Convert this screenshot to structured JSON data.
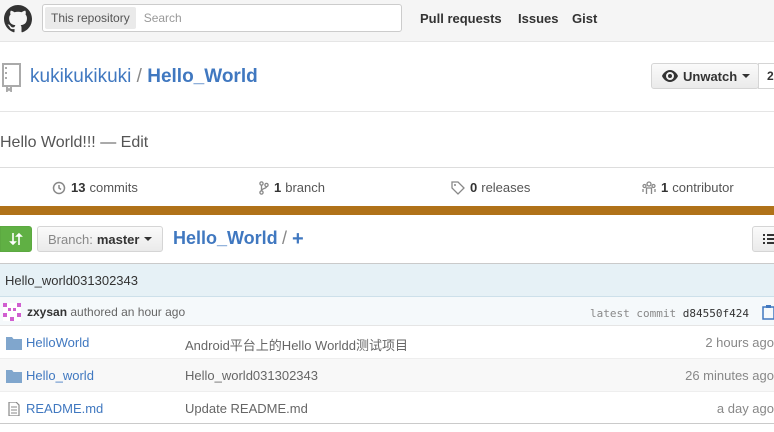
{
  "header": {
    "search_scope": "This repository",
    "search_placeholder": "Search",
    "nav": [
      "Pull requests",
      "Issues",
      "Gist"
    ]
  },
  "repo": {
    "owner": "kukikukikuki",
    "separator": "/",
    "name": "Hello_World",
    "watch_label": "Unwatch",
    "watch_count": "2",
    "description": "Hello World!!!",
    "description_sep": "—",
    "edit_label": "Edit"
  },
  "stats": {
    "commits": {
      "count": "13",
      "label": "commits"
    },
    "branches": {
      "count": "1",
      "label": "branch"
    },
    "releases": {
      "count": "0",
      "label": "releases"
    },
    "contributors": {
      "count": "1",
      "label": "contributor"
    }
  },
  "file_nav": {
    "branch_label": "Branch:",
    "branch_value": "master",
    "path": "Hello_World",
    "path_sep": "/",
    "add": "+"
  },
  "commit": {
    "message": "Hello_world031302343",
    "author": "zxysan",
    "authored_text": "authored an hour ago",
    "latest_label": "latest commit",
    "sha": "d84550f424"
  },
  "files": [
    {
      "name": "HelloWorld",
      "type": "folder",
      "message": "Android平台上的Hello Worldd测试项目",
      "age": "2 hours ago"
    },
    {
      "name": "Hello_world",
      "type": "folder",
      "message": "Hello_world031302343",
      "age": "26 minutes ago"
    },
    {
      "name": "README.md",
      "type": "file",
      "message": "Update README.md",
      "age": "a day ago"
    }
  ],
  "colors": {
    "link": "#4078c0",
    "language_bar": "#b07219",
    "compare_green": "#60b044"
  }
}
